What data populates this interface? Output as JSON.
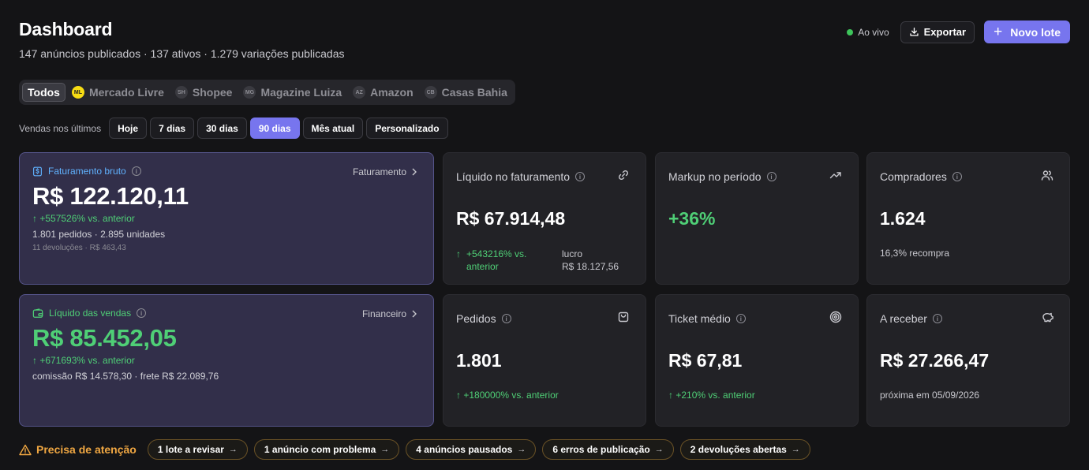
{
  "header": {
    "title": "Dashboard",
    "subtitle": "147 anúncios publicados · 137 ativos · 1.279 variações publicadas"
  },
  "actions": {
    "live": "Ao vivo",
    "export": "Exportar",
    "new_batch": "Novo lote"
  },
  "marketplaces": [
    {
      "label": "Todos",
      "badge": ""
    },
    {
      "label": "Mercado Livre",
      "badge": "ML"
    },
    {
      "label": "Shopee",
      "badge": "SH"
    },
    {
      "label": "Magazine Luiza",
      "badge": "MG"
    },
    {
      "label": "Amazon",
      "badge": "AZ"
    },
    {
      "label": "Casas Bahia",
      "badge": "CB"
    }
  ],
  "periods": {
    "label": "Vendas nos últimos",
    "options": [
      "Hoje",
      "7 dias",
      "30 dias",
      "90 dias",
      "Mês atual",
      "Personalizado"
    ],
    "selected": "90 dias"
  },
  "cards": {
    "gross": {
      "title": "Faturamento bruto",
      "link": "Faturamento",
      "value": "R$ 122.120,11",
      "delta": "↑ +557526% vs. anterior",
      "line1": "1.801 pedidos · 2.895 unidades",
      "line2": "11 devoluções · R$ 463,43"
    },
    "net_sales": {
      "title": "Líquido das vendas",
      "link": "Financeiro",
      "value": "R$ 85.452,05",
      "delta": "↑ +671693% vs. anterior",
      "line1": "comissão R$ 14.578,30 · frete R$ 22.089,76"
    },
    "net_billing": {
      "title": "Líquido no faturamento",
      "value": "R$ 67.914,48",
      "delta": "+543216% vs. anterior",
      "profit_label": "lucro",
      "profit_value": "R$ 18.127,56"
    },
    "markup": {
      "title": "Markup no período",
      "value": "+36%"
    },
    "buyers": {
      "title": "Compradores",
      "value": "1.624",
      "foot": "16,3% recompra"
    },
    "orders": {
      "title": "Pedidos",
      "value": "1.801",
      "foot": "↑ +180000% vs. anterior"
    },
    "ticket": {
      "title": "Ticket médio",
      "value": "R$ 67,81",
      "foot": "↑ +210% vs. anterior"
    },
    "receivable": {
      "title": "A receber",
      "value": "R$ 27.266,47",
      "foot": "próxima em 05/09/2026"
    }
  },
  "attention": {
    "label": "Precisa de atenção",
    "items": [
      "1 lote a revisar",
      "1 anúncio com problema",
      "4 anúncios pausados",
      "6 erros de publicação",
      "2 devoluções abertas"
    ]
  },
  "colors": {
    "accent": "#7775ee",
    "positive": "#4fcf76",
    "warning": "#f0a742",
    "info": "#60b2ff"
  }
}
